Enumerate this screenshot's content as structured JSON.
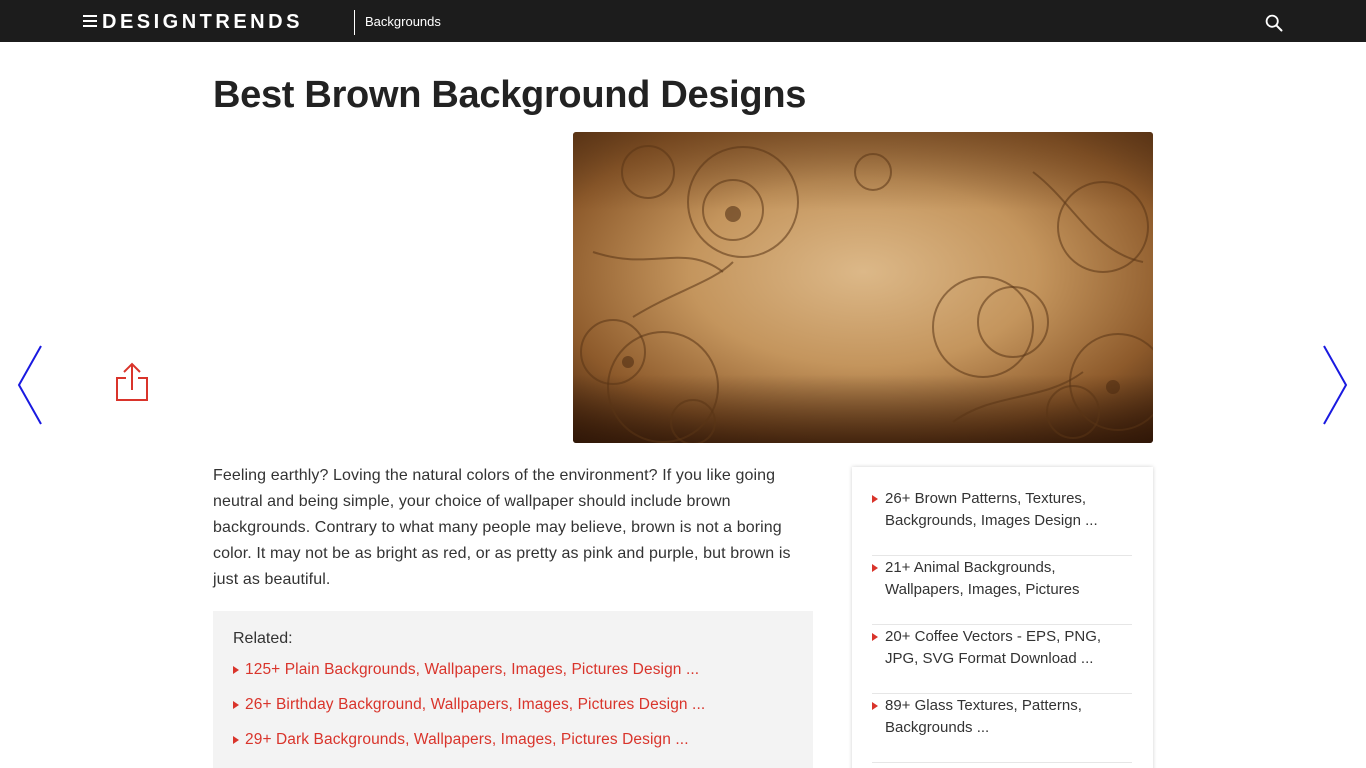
{
  "header": {
    "brand": "DESIGNTRENDS",
    "nav_link": "Backgrounds",
    "background_color": "#1c1c1c"
  },
  "icons": {
    "menu": "hamburger-menu-icon",
    "search": "search-icon",
    "share": "share-icon",
    "prev": "chevron-left-icon",
    "next": "chevron-right-icon"
  },
  "article": {
    "title": "Best Brown Background Designs",
    "intro": "Feeling earthly? Loving the natural colors of the environment? If you like going neutral and being simple, your choice of wallpaper should include brown backgrounds. Contrary to what many people may believe, brown is not a boring color. It may not be as bright as red, or as pretty as pink and purple, but brown is just as beautiful."
  },
  "related": {
    "heading": "Related:",
    "items": [
      "125+ Plain Backgrounds, Wallpapers, Images, Pictures Design ...",
      "26+ Birthday Background, Wallpapers, Images, Pictures Design ...",
      "29+ Dark Backgrounds, Wallpapers, Images, Pictures Design ..."
    ]
  },
  "sidebar": {
    "items": [
      "26+ Brown Patterns, Textures, Backgrounds, Images Design ...",
      "21+ Animal Backgrounds, Wallpapers, Images, Pictures",
      "20+ Coffee Vectors - EPS, PNG, JPG, SVG Format Download ...",
      "89+ Glass Textures, Patterns, Backgrounds ..."
    ]
  },
  "colors": {
    "accent_red": "#d9342b",
    "nav_arrow_blue": "#1a1ae0",
    "hero_light": "#d8b382",
    "hero_dark": "#3a1d0a"
  }
}
